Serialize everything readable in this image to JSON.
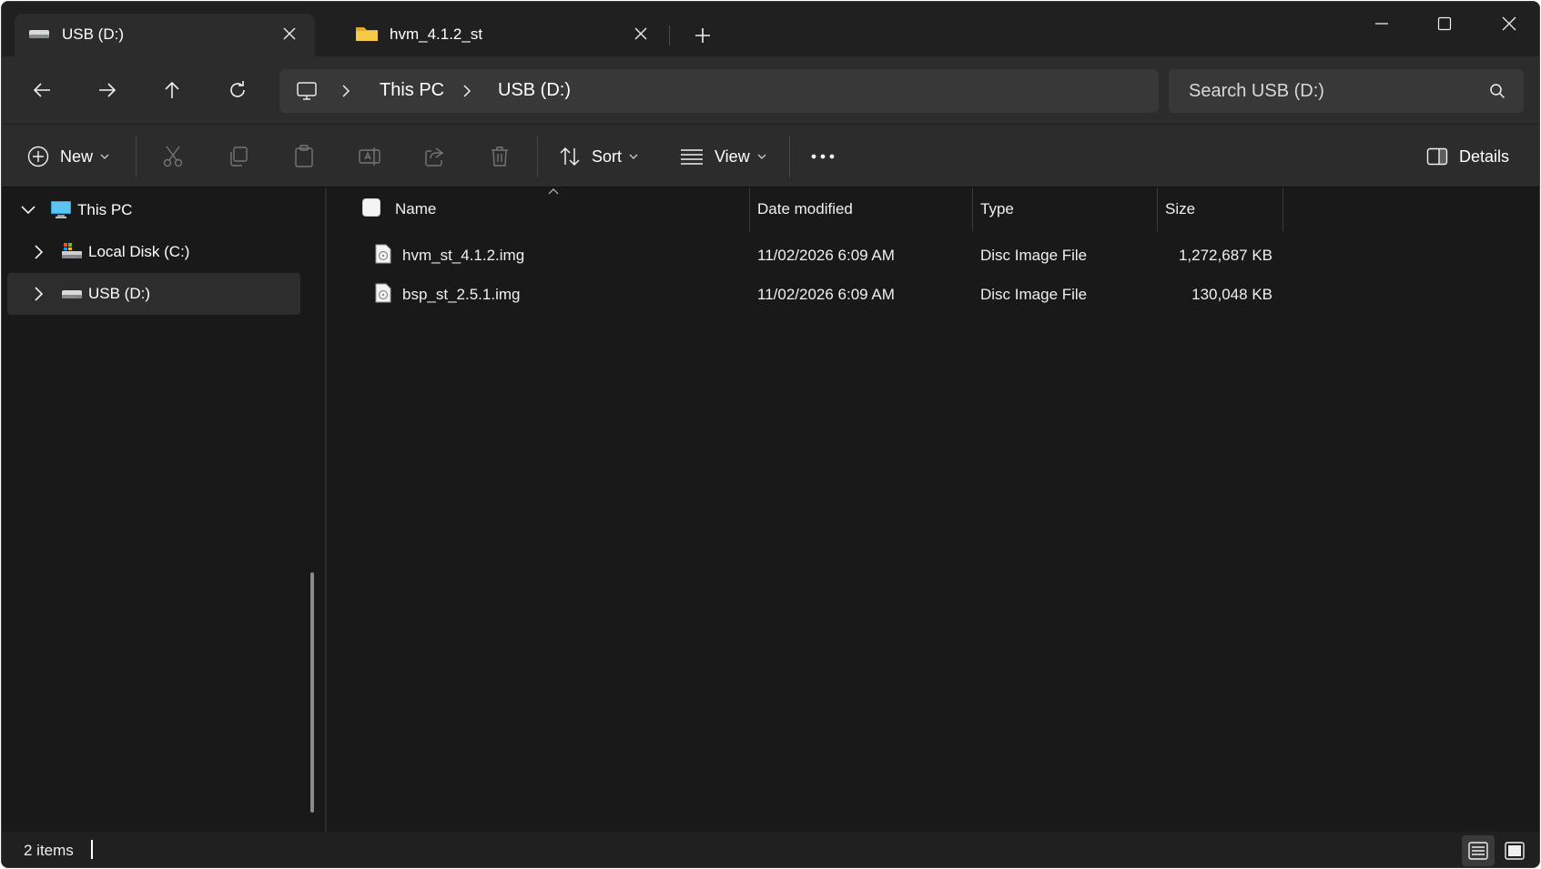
{
  "tabs": [
    {
      "label": "USB (D:)",
      "icon": "drive-icon",
      "active": true
    },
    {
      "label": "hvm_4.1.2_st",
      "icon": "folder-icon",
      "active": false
    }
  ],
  "breadcrumb": [
    "This PC",
    "USB (D:)"
  ],
  "search": {
    "placeholder": "Search USB (D:)"
  },
  "toolbar": {
    "new_label": "New",
    "sort_label": "Sort",
    "view_label": "View",
    "details_label": "Details"
  },
  "sidebar": {
    "items": [
      {
        "label": "This PC",
        "icon": "monitor-icon",
        "expanded": true
      },
      {
        "label": "Local Disk (C:)",
        "icon": "local-disk-icon",
        "expanded": false
      },
      {
        "label": "USB (D:)",
        "icon": "usb-drive-icon",
        "expanded": false,
        "selected": true
      }
    ]
  },
  "columns": {
    "name": "Name",
    "date_modified": "Date modified",
    "type": "Type",
    "size": "Size"
  },
  "files": [
    {
      "name": "hvm_st_4.1.2.img",
      "date": "11/02/2026 6:09 AM",
      "type": "Disc Image File",
      "size": "1,272,687 KB"
    },
    {
      "name": "bsp_st_2.5.1.img",
      "date": "11/02/2026 6:09 AM",
      "type": "Disc Image File",
      "size": "130,048 KB"
    }
  ],
  "status": {
    "item_count": "2 items"
  },
  "colors": {
    "background": "#191919",
    "toolbar": "#2c2c2c",
    "accent": "#60cdff"
  }
}
